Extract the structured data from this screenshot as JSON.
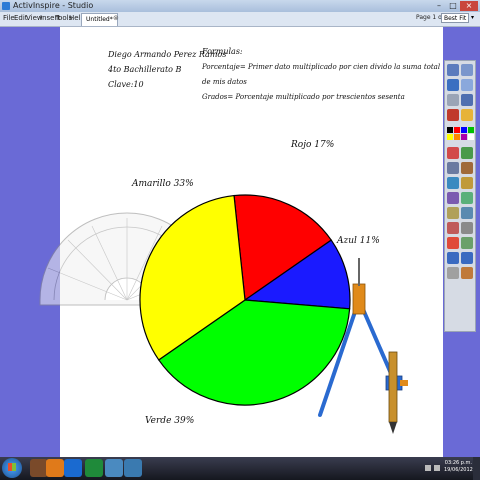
{
  "window": {
    "title": "ActivInspire - Studio"
  },
  "menu": {
    "items": [
      "File",
      "Edit",
      "View",
      "Insert",
      "Tools",
      "Help"
    ]
  },
  "tab": {
    "label": "Untitled*"
  },
  "pager": {
    "label": "Page 1 of 1",
    "zoom": "Best Fit"
  },
  "notes": {
    "author": "Diego Armando Perez Ramos",
    "grade": "4to Bachillerato B",
    "clave": "Clave:10",
    "formulas_title": "Formulas:",
    "formula1": "Porcentaje= Primer dato multiplicado por cien divido la suma total",
    "formula1b": "de mis datos",
    "formula2": "Grados= Porcentaje multiplicado por trescientos sesenta"
  },
  "chart_data": {
    "type": "pie",
    "slices": [
      {
        "label": "Rojo 17%",
        "value": 17,
        "color": "#ff0000"
      },
      {
        "label": "Azul 11%",
        "value": 11,
        "color": "#1a1aff"
      },
      {
        "label": "Verde 39%",
        "value": 39,
        "color": "#00ff00"
      },
      {
        "label": "Amarillo 33%",
        "value": 33,
        "color": "#ffff00"
      }
    ]
  },
  "clock": {
    "time": "03:26 p.m.",
    "date": "19/06/2012"
  },
  "colors": {
    "desktop": "#6a6ad6",
    "toolbar": "#d6dbe4"
  }
}
